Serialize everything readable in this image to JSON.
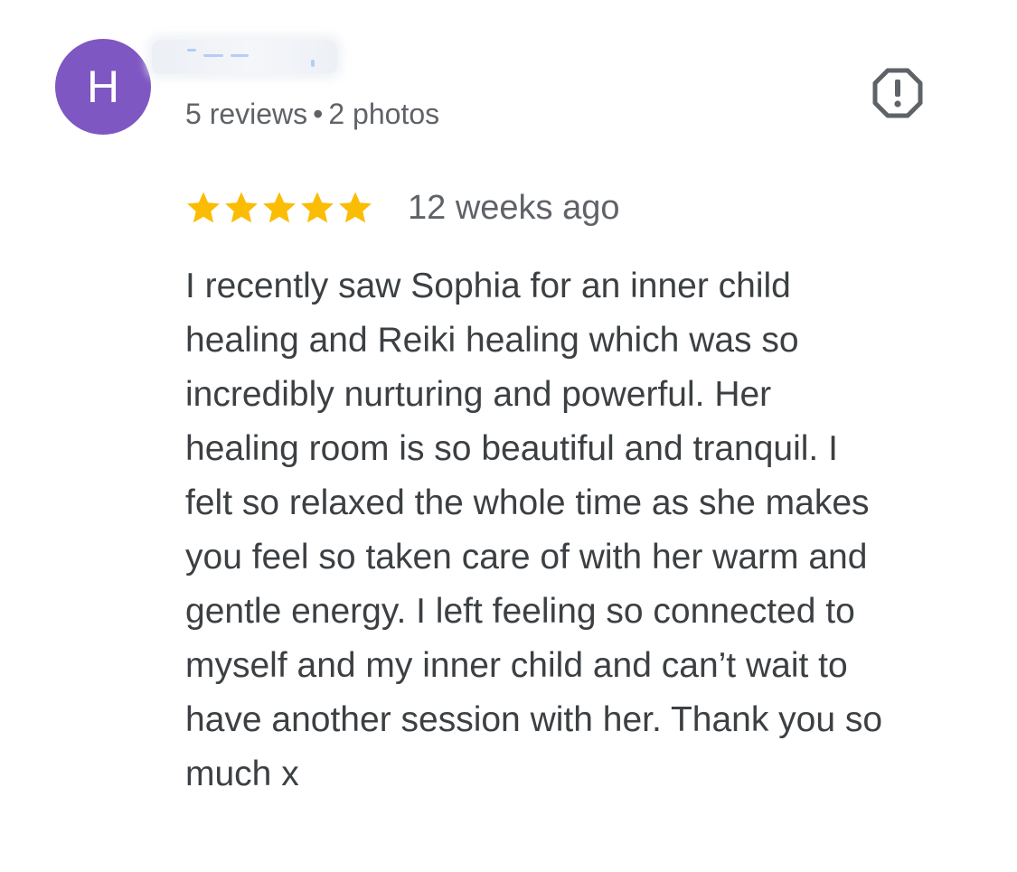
{
  "reviewer": {
    "avatar_letter": "H",
    "avatar_color": "#7e57c2",
    "name": "",
    "reviews_count": "5 reviews",
    "separator": "•",
    "photos_count": "2 photos"
  },
  "actions": {
    "report_icon": "report-octagon-icon"
  },
  "rating": {
    "stars": 5,
    "max_stars": 5,
    "star_color": "#fbbc04",
    "date": "12 weeks ago"
  },
  "review": {
    "lines": [
      "I recently saw Sophia for an inner child",
      "healing and Reiki healing which was so",
      "incredibly nurturing and powerful. Her",
      "healing room is so beautiful and tranquil. I",
      "felt so relaxed the whole time as she makes",
      "you feel so taken care of with her warm and",
      "gentle energy. I left feeling so connected to",
      "myself and my inner child and can’t wait to",
      "have another session with her. Thank you so",
      "much x"
    ]
  }
}
